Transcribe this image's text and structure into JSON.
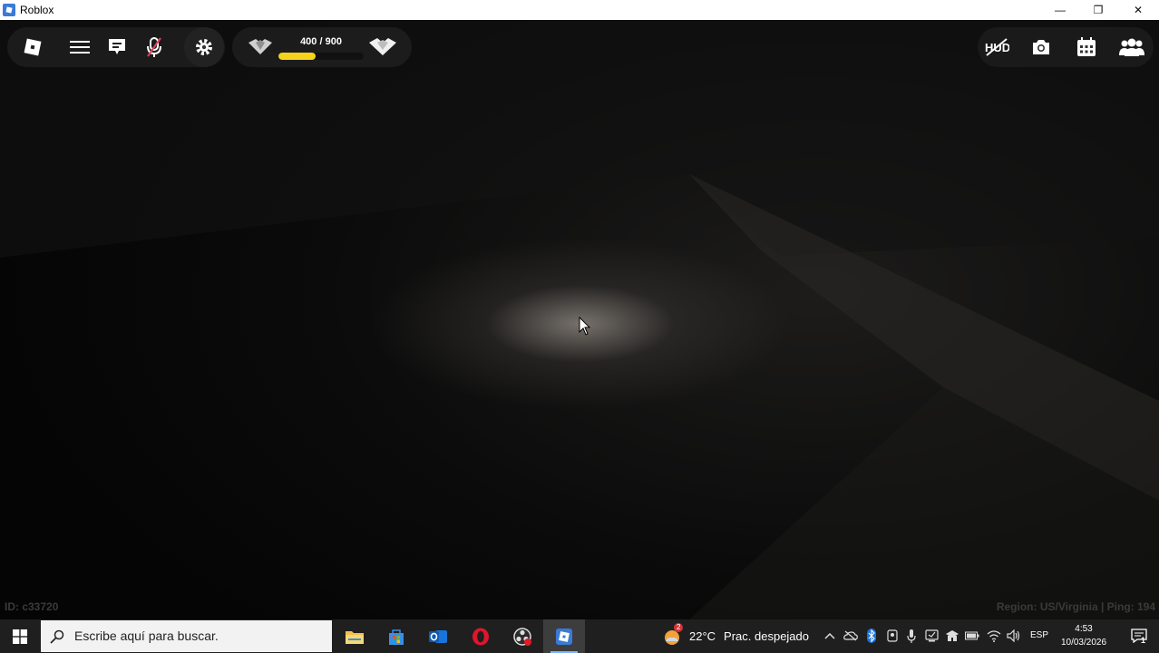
{
  "window": {
    "title": "Roblox",
    "minimize_glyph": "—",
    "restore_glyph": "❐",
    "close_glyph": "✕"
  },
  "hud": {
    "xp_text": "400 / 900",
    "xp_progress": 0.44,
    "xp_color": "#f5d31a",
    "left_icons": [
      "roblox-logo-icon",
      "menu-icon",
      "chat-icon",
      "microphone-muted-icon",
      "settings-icon"
    ],
    "right_icons": [
      "hide-hud-icon",
      "camera-icon",
      "calendar-icon",
      "friends-icon"
    ]
  },
  "footer": {
    "id_text": "ID: c33720",
    "region_text": "Region: US/Virginia | Ping: 194"
  },
  "taskbar": {
    "search_placeholder": "Escribe aquí para buscar.",
    "weather_temp": "22°C",
    "weather_desc": "Prac. despejado",
    "weather_badge": "2",
    "language": "ESP",
    "time": "4:53",
    "date": "10/03/2026",
    "notification_count": "1",
    "pinned_apps": [
      "file-explorer-icon",
      "microsoft-store-icon",
      "outlook-icon",
      "opera-icon",
      "obs-icon",
      "roblox-icon"
    ]
  }
}
